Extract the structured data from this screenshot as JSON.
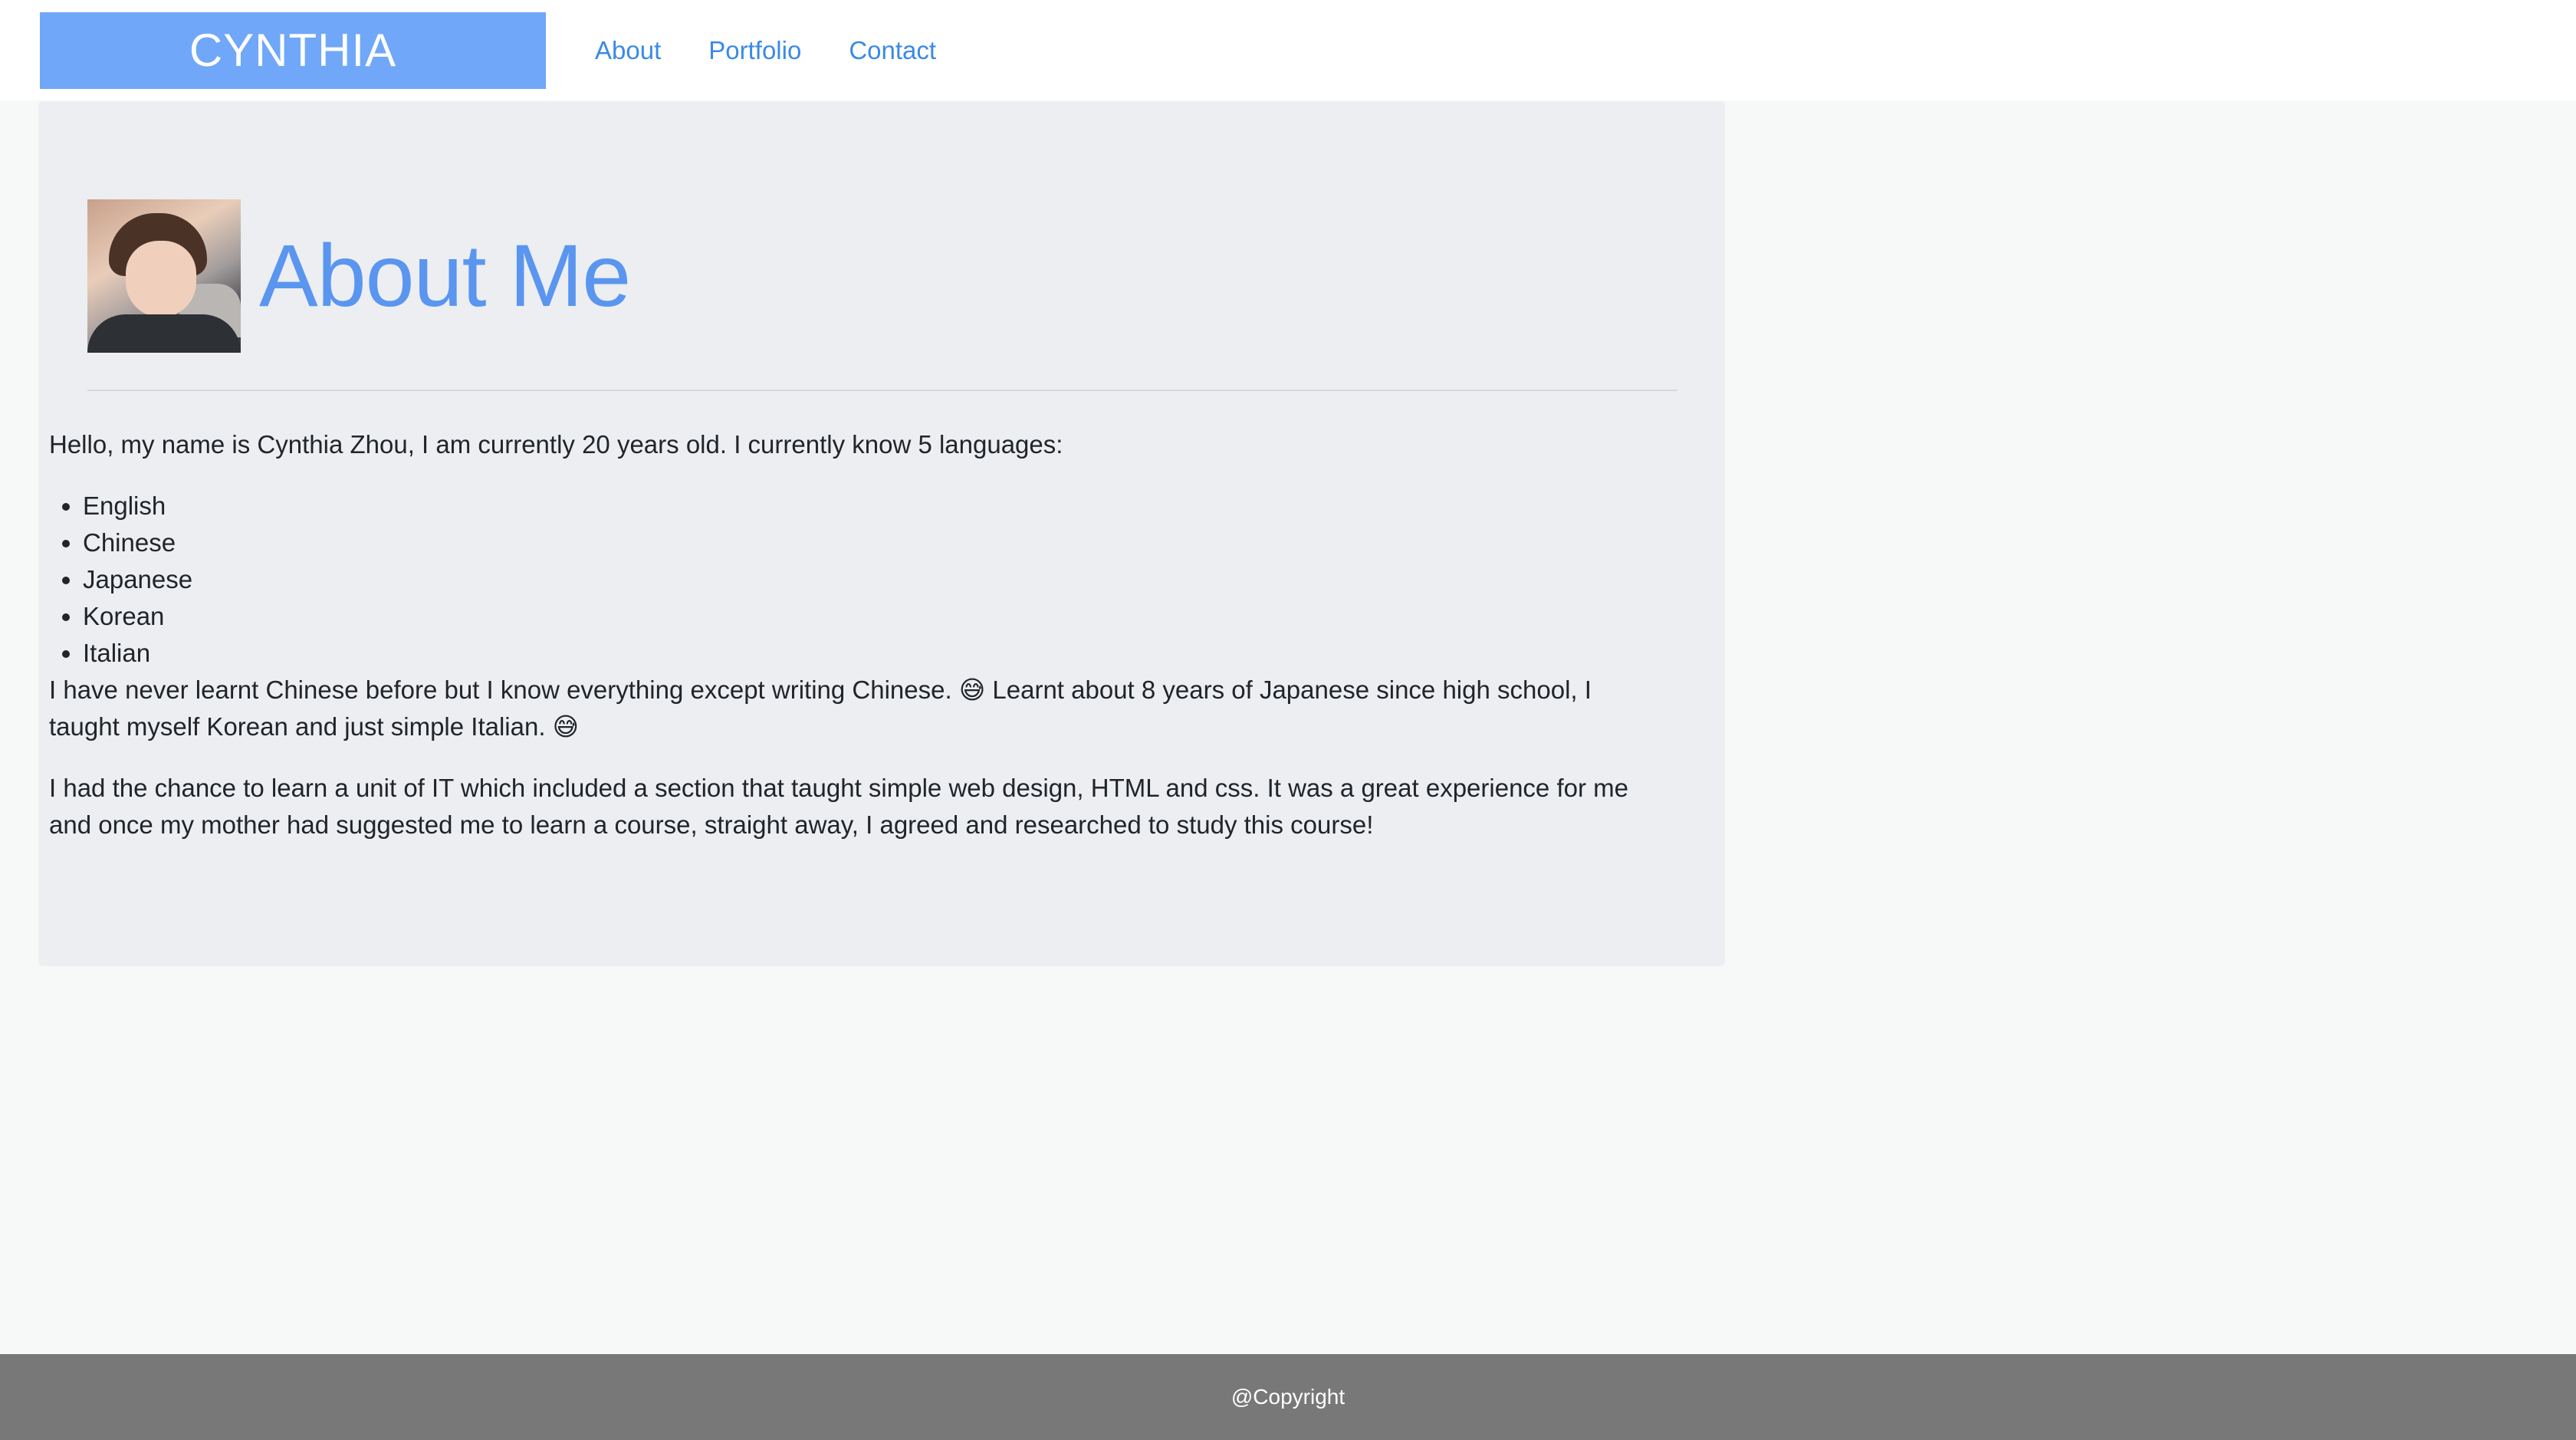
{
  "navbar": {
    "brand": "CYNTHIA",
    "links": [
      {
        "label": "About"
      },
      {
        "label": "Portfolio"
      },
      {
        "label": "Contact"
      }
    ]
  },
  "about": {
    "title": "About Me",
    "intro": "Hello, my name is Cynthia Zhou, I am currently 20 years old. I currently know 5 languages:",
    "languages": [
      "English",
      "Chinese",
      "Japanese",
      "Korean",
      "Italian"
    ],
    "paragraph1": "I have never learnt Chinese before but I know everything except writing Chinese. 😅  Learnt about 8 years of Japanese since high school, I taught myself Korean and just simple Italian. 😅",
    "paragraph2": "I had the chance to learn a unit of IT which included a section that taught simple web design, HTML and css. It was a great experience for me and once my mother had suggested me to learn a course, straight away, I agreed and researched to study this course!"
  },
  "footer": {
    "text": "@Copyright"
  },
  "colors": {
    "brand_bg": "#70a7f8",
    "link": "#3b8ae6",
    "title": "#5a96ef",
    "panel_bg": "#eceef1",
    "footer_bg": "#787878"
  }
}
